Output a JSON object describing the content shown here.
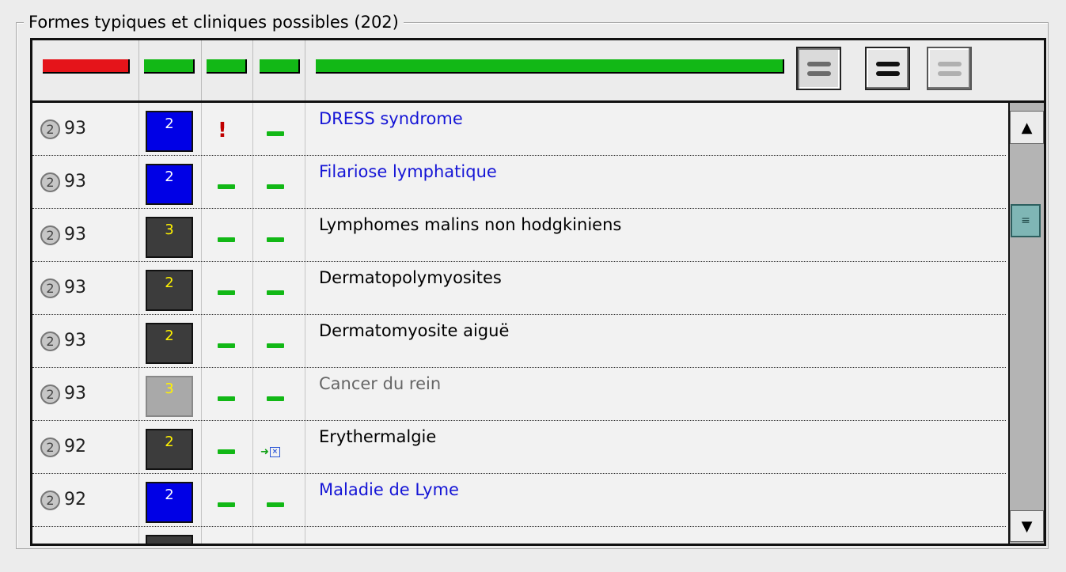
{
  "group": {
    "title": "Formes typiques et cliniques possibles (202)"
  },
  "header": {
    "bars": [
      {
        "color": "#e5141a"
      },
      {
        "color": "#12b816"
      },
      {
        "color": "#12b816"
      },
      {
        "color": "#12b816"
      },
      {
        "color": "#12b816"
      }
    ],
    "view_buttons": [
      {
        "icon": "two-lines-gray-icon",
        "state": "pressed"
      },
      {
        "icon": "two-lines-black-icon",
        "state": "raised"
      },
      {
        "icon": "two-lines-dim-icon",
        "state": "disabled"
      }
    ]
  },
  "rows": [
    {
      "rank": "2",
      "score": "93",
      "level": "2",
      "level_style": "blue",
      "flag": "warning",
      "extra": "dash",
      "name": "DRESS syndrome",
      "name_color": "blue"
    },
    {
      "rank": "2",
      "score": "93",
      "level": "2",
      "level_style": "blue",
      "flag": "dash",
      "extra": "dash",
      "name": "Filariose lymphatique",
      "name_color": "blue"
    },
    {
      "rank": "2",
      "score": "93",
      "level": "3",
      "level_style": "dark",
      "flag": "dash",
      "extra": "dash",
      "name": "Lymphomes malins non hodgkiniens",
      "name_color": "black"
    },
    {
      "rank": "2",
      "score": "93",
      "level": "2",
      "level_style": "dark",
      "flag": "dash",
      "extra": "dash",
      "name": "Dermatopolymyosites",
      "name_color": "black"
    },
    {
      "rank": "2",
      "score": "93",
      "level": "2",
      "level_style": "dark",
      "flag": "dash",
      "extra": "dash",
      "name": "Dermatomyosite aiguë",
      "name_color": "black"
    },
    {
      "rank": "2",
      "score": "93",
      "level": "3",
      "level_style": "light",
      "flag": "dash",
      "extra": "dash",
      "name": "Cancer du rein",
      "name_color": "gray"
    },
    {
      "rank": "2",
      "score": "92",
      "level": "2",
      "level_style": "dark",
      "flag": "dash",
      "extra": "link",
      "name": "Erythermalgie",
      "name_color": "black"
    },
    {
      "rank": "2",
      "score": "92",
      "level": "2",
      "level_style": "blue",
      "flag": "dash",
      "extra": "dash",
      "name": "Maladie de Lyme",
      "name_color": "blue"
    }
  ],
  "scrollbar": {
    "position": 0.23
  }
}
